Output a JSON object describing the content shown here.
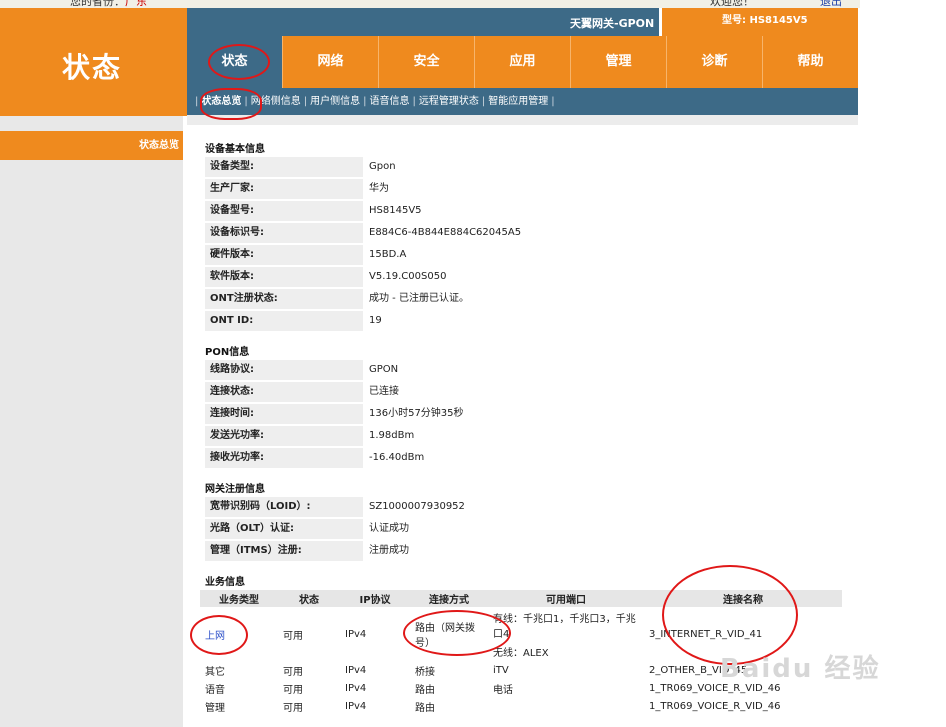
{
  "topbar": {
    "greeting_prefix": "您的省份：",
    "province": "广东",
    "welcome": "欢迎您！",
    "logout": "退出"
  },
  "brand": {
    "title": "状态"
  },
  "header": {
    "gateway": "天翼网关-GPON",
    "model": "型号: HS8145V5"
  },
  "nav": {
    "tabs": [
      "状态",
      "网络",
      "安全",
      "应用",
      "管理",
      "诊断",
      "帮助"
    ],
    "active_index": 0
  },
  "subnav": {
    "items": [
      "状态总览",
      "网络侧信息",
      "用户侧信息",
      "语音信息",
      "远程管理状态",
      "智能应用管理"
    ],
    "active_index": 0
  },
  "sidebar": {
    "item": "状态总览"
  },
  "device": {
    "title": "设备基本信息",
    "rows": [
      {
        "label": "设备类型:",
        "value": "Gpon"
      },
      {
        "label": "生产厂家:",
        "value": "华为"
      },
      {
        "label": "设备型号:",
        "value": "HS8145V5"
      },
      {
        "label": "设备标识号:",
        "value": "E884C6-4B844E884C62045A5"
      },
      {
        "label": "硬件版本:",
        "value": "15BD.A"
      },
      {
        "label": "软件版本:",
        "value": "V5.19.C00S050"
      },
      {
        "label": "ONT注册状态:",
        "value": "成功 - 已注册已认证。"
      },
      {
        "label": "ONT ID:",
        "value": "19"
      }
    ]
  },
  "pon": {
    "title": "PON信息",
    "rows": [
      {
        "label": "线路协议:",
        "value": "GPON"
      },
      {
        "label": "连接状态:",
        "value": "已连接"
      },
      {
        "label": "连接时间:",
        "value": "136小时57分钟35秒"
      },
      {
        "label": "发送光功率:",
        "value": "1.98dBm"
      },
      {
        "label": "接收光功率:",
        "value": "-16.40dBm"
      }
    ]
  },
  "gateway_reg": {
    "title": "网关注册信息",
    "rows": [
      {
        "label": "宽带识别码（LOID）:",
        "value": "SZ1000007930952"
      },
      {
        "label": "光路（OLT）认证:",
        "value": "认证成功"
      },
      {
        "label": "管理（ITMS）注册:",
        "value": "注册成功"
      }
    ]
  },
  "services": {
    "title": "业务信息",
    "headers": [
      "业务类型",
      "状态",
      "IP协议",
      "连接方式",
      "可用端口",
      "连接名称"
    ],
    "rows": [
      {
        "type": "上网",
        "status": "可用",
        "ip": "IPv4",
        "mode": "路由（网关拨号）",
        "ports": "有线：千兆口1，千兆口3，千兆口4",
        "ports2": "无线：ALEX",
        "name": "3_INTERNET_R_VID_41"
      },
      {
        "type": "其它",
        "status": "可用",
        "ip": "IPv4",
        "mode": "桥接",
        "ports": "iTV",
        "ports2": "",
        "name": "2_OTHER_B_VID_45"
      },
      {
        "type": "语音",
        "status": "可用",
        "ip": "IPv4",
        "mode": "路由",
        "ports": "电话",
        "ports2": "",
        "name": "1_TR069_VOICE_R_VID_46"
      },
      {
        "type": "管理",
        "status": "可用",
        "ip": "IPv4",
        "mode": "路由",
        "ports": "",
        "ports2": "",
        "name": "1_TR069_VOICE_R_VID_46"
      }
    ]
  },
  "watermark": "Baidu 经验",
  "colors": {
    "orange": "#ef8a1e",
    "blue": "#3d6a87",
    "annotation_red": "#e01818"
  }
}
